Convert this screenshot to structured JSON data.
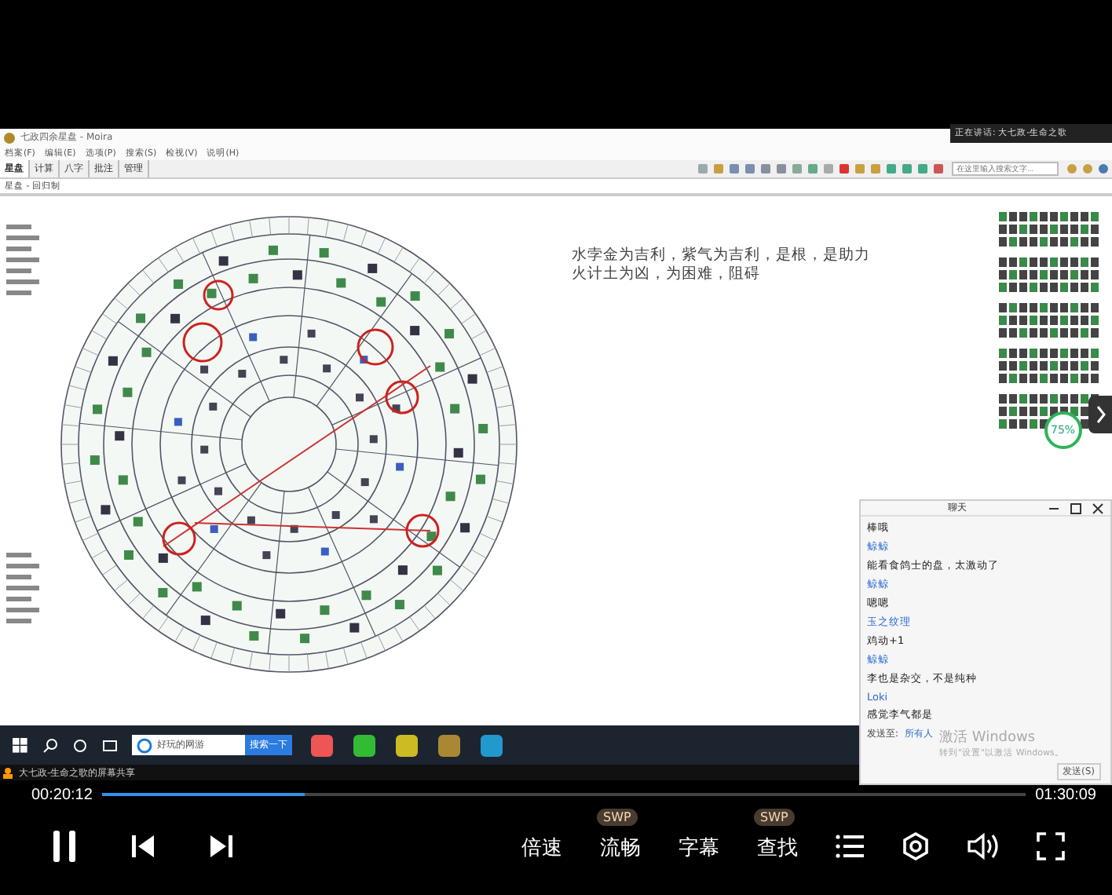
{
  "top_notice": {
    "text": "正在讲话: 大七政-生命之歌"
  },
  "app": {
    "title": "七政四余星盘 - Moira",
    "menus": [
      "档案(F)",
      "编辑(E)",
      "选项(P)",
      "搜索(S)",
      "检视(V)",
      "说明(H)"
    ],
    "tabs": [
      {
        "label": "星盘",
        "selected": true
      },
      {
        "label": "计算",
        "selected": false
      },
      {
        "label": "八字",
        "selected": false
      },
      {
        "label": "批注",
        "selected": false
      },
      {
        "label": "管理",
        "selected": false
      }
    ],
    "search": {
      "placeholder": "在这里输入搜索文字..."
    },
    "breadcrumb": "星盘 - 回归制",
    "note": [
      "水孛金为吉利，紫气为吉利，是根，是助力",
      "火计土为凶，为困难，阻碍"
    ],
    "progress_badge": {
      "text": "75%"
    }
  },
  "chat": {
    "title": "聊天",
    "messages": [
      {
        "kind": "text",
        "text": "棒哦"
      },
      {
        "kind": "sender",
        "text": "鲸鲸"
      },
      {
        "kind": "text",
        "text": "能看食鸽士的盘，太激动了"
      },
      {
        "kind": "sender",
        "text": "鲸鲸"
      },
      {
        "kind": "text",
        "text": "嗯嗯"
      },
      {
        "kind": "sender",
        "text": "玉之纹理"
      },
      {
        "kind": "text",
        "text": "鸡动+1"
      },
      {
        "kind": "sender",
        "text": "鲸鲸"
      },
      {
        "kind": "text",
        "text": "李也是杂交，不是纯种"
      },
      {
        "kind": "sender",
        "text": "Loki"
      },
      {
        "kind": "text",
        "text": "感觉李气都是"
      }
    ],
    "send_to_label": "发送至:",
    "recipient": "所有人",
    "send_button": "发送(S)"
  },
  "windows_activation": {
    "title": "激活 Windows",
    "hint": "转到\"设置\"以激活 Windows。"
  },
  "taskbar": {
    "search_text": "好玩的网游",
    "search_button": "搜索一下"
  },
  "share_label": "大七政-生命之歌的屏幕共享",
  "player": {
    "elapsed": "00:20:12",
    "total": "01:30:09",
    "level": 0.22,
    "playing": true,
    "options": [
      {
        "label": "倍速"
      },
      {
        "label": "流畅",
        "badge": "SWP"
      },
      {
        "label": "字幕"
      },
      {
        "label": "查找",
        "badge": "SWP"
      }
    ]
  }
}
